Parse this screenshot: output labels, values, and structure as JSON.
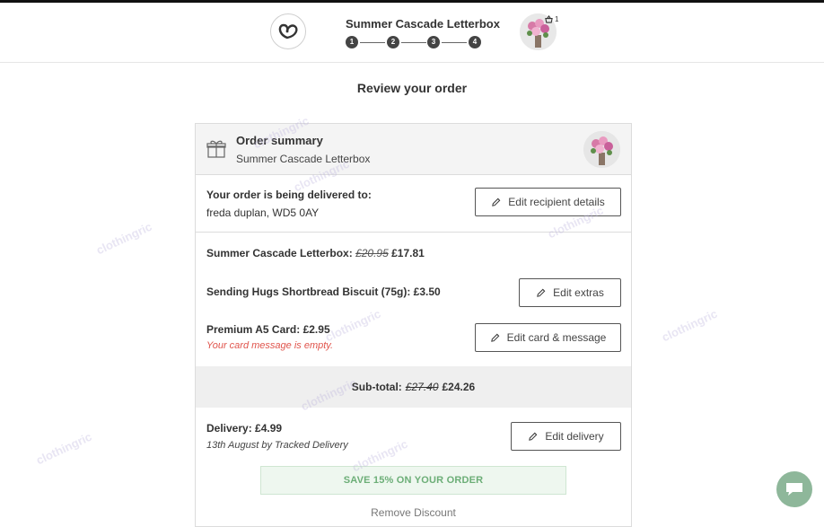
{
  "header": {
    "product_title": "Summer Cascade Letterbox",
    "steps": [
      "1",
      "2",
      "3",
      "4"
    ],
    "cart_count": "1"
  },
  "page": {
    "title": "Review your order"
  },
  "summary": {
    "title": "Order summary",
    "subtitle": "Summer Cascade Letterbox"
  },
  "recipient": {
    "label": "Your order is being delivered to:",
    "name": "freda duplan, WD5 0AY",
    "edit_label": "Edit recipient details"
  },
  "items": [
    {
      "label": "Summer Cascade Letterbox: ",
      "old_price": "£20.95",
      "price": " £17.81"
    },
    {
      "label": "Sending Hugs Shortbread Biscuit (75g): £3.50"
    },
    {
      "label": "Premium A5 Card: £2.95"
    }
  ],
  "card_warning": "Your card message is empty.",
  "buttons": {
    "edit_extras": "Edit extras",
    "edit_card": "Edit card & message",
    "edit_delivery": "Edit delivery"
  },
  "subtotal": {
    "label": "Sub-total:",
    "old": "£27.40",
    "new": "£24.26"
  },
  "delivery": {
    "label": "Delivery: £4.99",
    "date": "13th August by Tracked Delivery"
  },
  "discount": {
    "banner": "SAVE 15% ON YOUR ORDER",
    "remove": "Remove Discount"
  },
  "watermark": "clothingric",
  "colors": {
    "warning": "#e0544c",
    "discount_text": "#6cae77",
    "chat": "#8eb79a"
  }
}
